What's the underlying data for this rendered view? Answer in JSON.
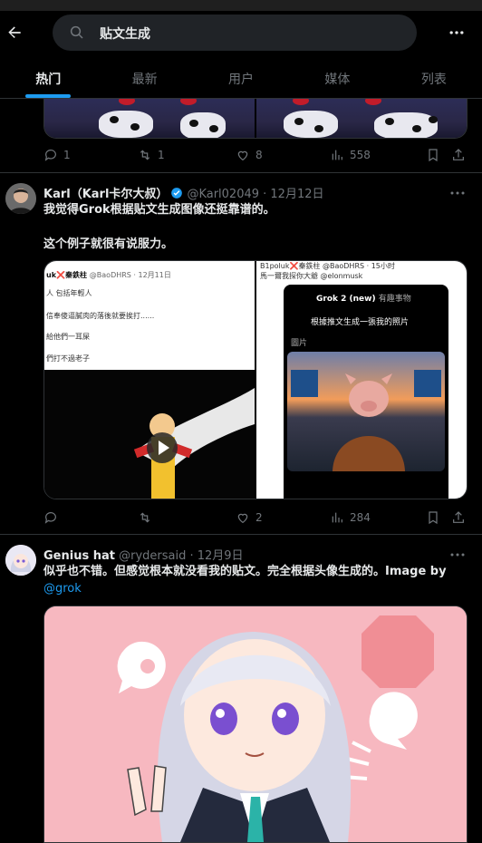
{
  "header": {
    "search_query": "贴文生成",
    "tabs": [
      {
        "label": "热门",
        "active": true
      },
      {
        "label": "最新",
        "active": false
      },
      {
        "label": "用户",
        "active": false
      },
      {
        "label": "媒体",
        "active": false
      },
      {
        "label": "列表",
        "active": false
      }
    ]
  },
  "tweet1": {
    "replies": "1",
    "retweets": "1",
    "likes": "8",
    "views": "558"
  },
  "tweet2": {
    "name": "Karl（Karl卡尔大叔）",
    "handle": "@Karl02049 · 12月12日",
    "text_line1": "我觉得Grok根据贴文生成图像还挺靠谱的。",
    "text_line2": "这个例子就很有说服力。",
    "media_left": {
      "header_user": "uk",
      "header_name": "秦鉄柱",
      "header_handle": "@BaoDHRS · 12月11日",
      "lines": [
        "人 包括年輕人",
        "信奉傻逼膩肉的落後就要挨打......",
        "給他們一耳屎",
        "們打不過老子"
      ]
    },
    "media_right": {
      "header": "B1poluk❌秦鉄柱 @BaoDHRS · 15小时",
      "reply": "馬一爾我探你大爺 @elonmusk",
      "grok_title": "Grok 2 (new)",
      "grok_menu": "有趣事物",
      "prompt": "根據推文生成一張我的照片",
      "caption": "圖片"
    },
    "replies": "",
    "retweets": "",
    "likes": "2",
    "views": "284"
  },
  "tweet3": {
    "name": "Genius hat",
    "handle": "@rydersaid · 12月9日",
    "text": "似乎也不错。但感觉根本就没看我的贴文。完全根据头像生成的。Image by",
    "mention": "@grok"
  },
  "colors": {
    "accent": "#1d9bf0",
    "background": "#000000",
    "muted": "#71767b"
  }
}
